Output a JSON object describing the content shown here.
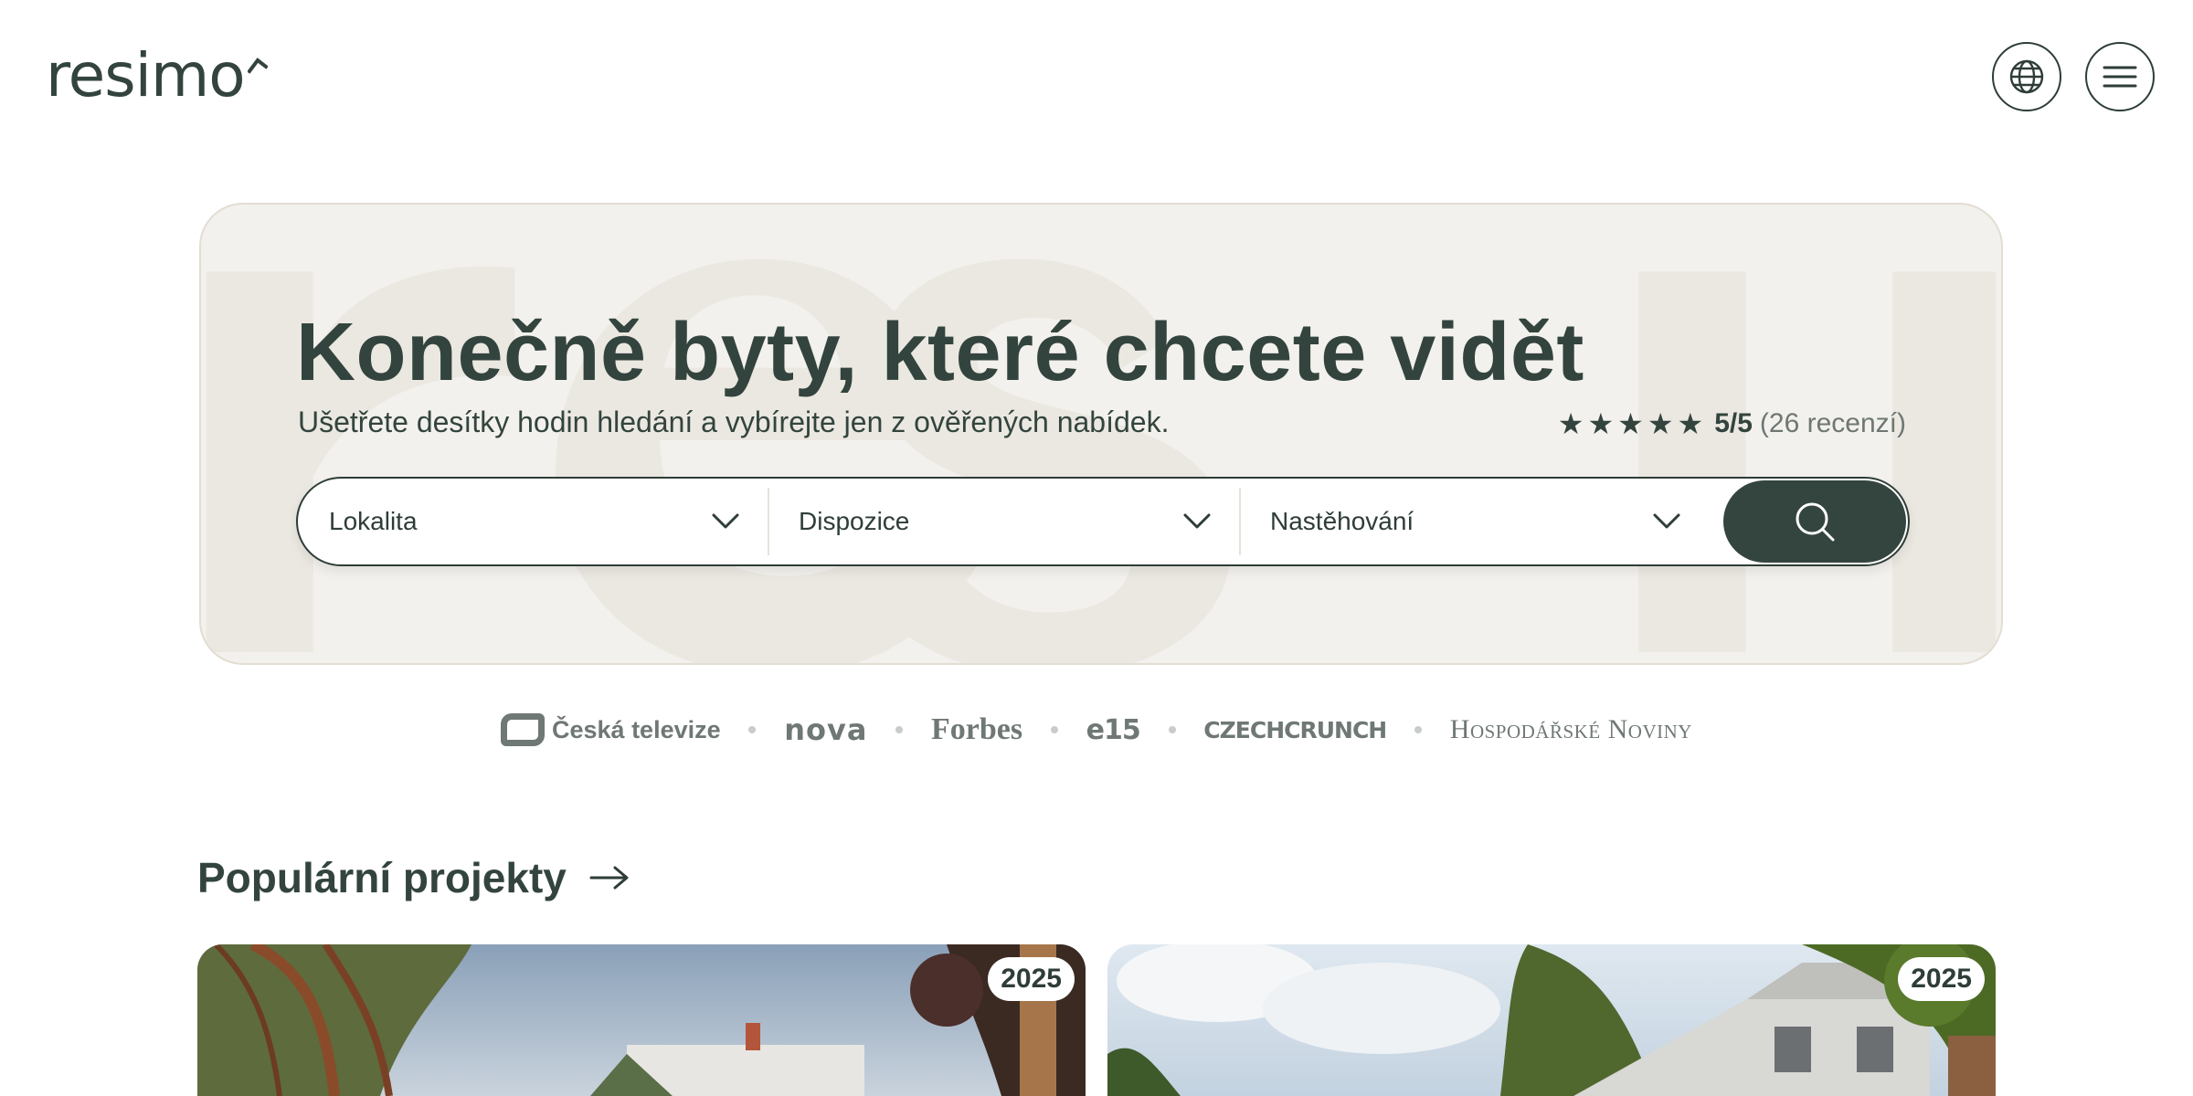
{
  "header": {
    "logo_text": "resimo",
    "logo_mark_icon": "roof-chevron-icon",
    "language_icon": "globe-icon",
    "menu_icon": "hamburger-icon"
  },
  "hero": {
    "background_text": "resimo",
    "title": "Konečně byty, které chcete vidět",
    "subtitle": "Ušetřete desítky hodin hledání a vybírejte jen z ověřených nabídek.",
    "rating": {
      "stars": 5,
      "score": "5/5",
      "count": "(26 recenzí)"
    },
    "search": {
      "fields": [
        {
          "label": "Lokalita",
          "icon": "chevron-down-icon"
        },
        {
          "label": "Dispozice",
          "icon": "chevron-down-icon"
        },
        {
          "label": "Nastěhování",
          "icon": "chevron-down-icon"
        }
      ],
      "button_icon": "search-icon"
    }
  },
  "press": {
    "logos": [
      "Česká televize",
      "nova",
      "Forbes",
      "e15",
      "CZECHCRUNCH",
      "Hospodářské Noviny"
    ]
  },
  "projects": {
    "title": "Populární projekty",
    "arrow_icon": "arrow-right-icon",
    "cards": [
      {
        "year": "2025"
      },
      {
        "year": "2025"
      }
    ]
  },
  "colors": {
    "brand_dark": "#33443e",
    "hero_bg": "#f3f1ed",
    "muted": "#6f7874"
  }
}
